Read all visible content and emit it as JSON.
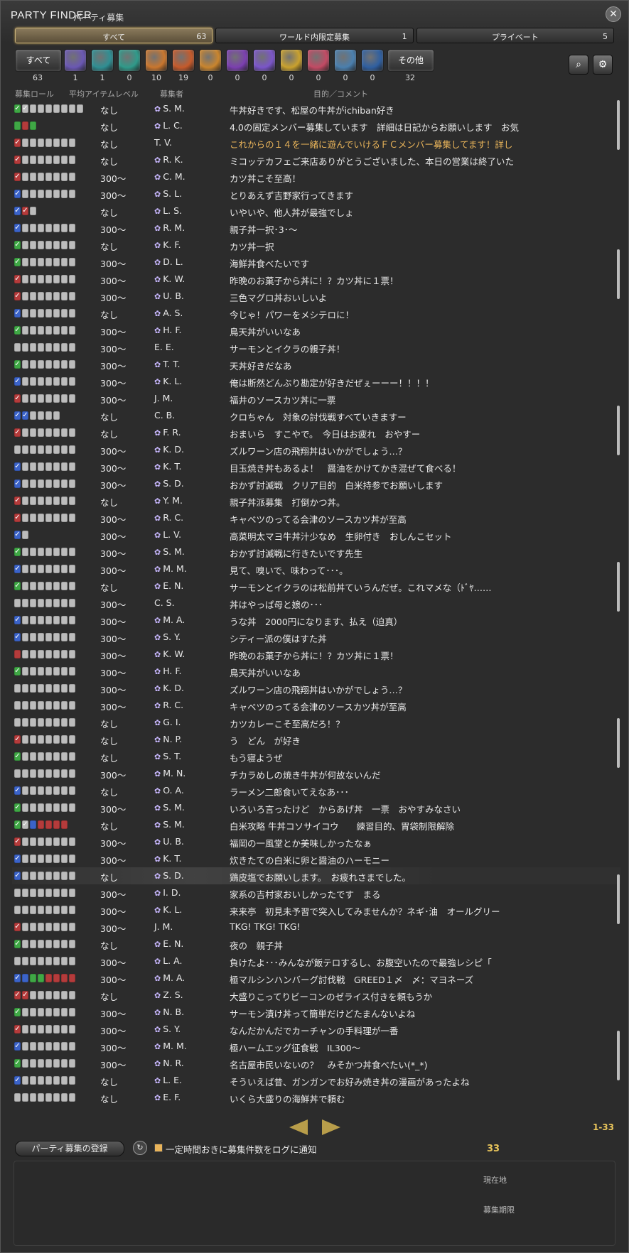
{
  "window": {
    "title": "PARTY FINDER",
    "subtitle": "パーティ募集",
    "close_icon": "close-icon"
  },
  "tabs": [
    {
      "label": "すべて",
      "count": "63"
    },
    {
      "label": "ワールド内限定募集",
      "count": "1"
    },
    {
      "label": "プライベート",
      "count": "5"
    }
  ],
  "filters": [
    {
      "label": "すべて",
      "count": "63",
      "color": "#555555"
    },
    {
      "icon": "dungeon-icon",
      "count": "1",
      "color": "#6a57b3"
    },
    {
      "icon": "guildhest-icon",
      "count": "1",
      "color": "#2f8f93"
    },
    {
      "icon": "trial-icon",
      "count": "0",
      "color": "#2f9a8a"
    },
    {
      "icon": "raid-icon",
      "count": "10",
      "color": "#c9762e"
    },
    {
      "icon": "high-end-icon",
      "count": "19",
      "color": "#c55a2b"
    },
    {
      "icon": "pvp-icon",
      "count": "0",
      "color": "#c9852e"
    },
    {
      "icon": "quest-battle-icon",
      "count": "0",
      "color": "#7b3fb0"
    },
    {
      "icon": "fate-icon",
      "count": "0",
      "color": "#7a55c9"
    },
    {
      "icon": "treasure-hunt-icon",
      "count": "0",
      "color": "#c9a12e"
    },
    {
      "icon": "hunt-icon",
      "count": "0",
      "color": "#c24a64"
    },
    {
      "icon": "gathering-icon",
      "count": "0",
      "color": "#4a7fae"
    },
    {
      "icon": "deep-dungeon-icon",
      "count": "0",
      "color": "#2f5fa0"
    },
    {
      "label": "その他",
      "count": "32",
      "color": "#555555"
    }
  ],
  "columns": {
    "role": "募集ロール",
    "ilvl": "平均アイテムレベル",
    "recruiter": "募集者",
    "comment": "目的／コメント"
  },
  "rows": [
    {
      "roles": "HG0000000",
      "ilvl": "なし",
      "name": "S. M.",
      "comment": "牛丼好きです、松屋の牛丼がichiban好き"
    },
    {
      "roles": "hdg",
      "ilvl": "なし",
      "name": "L. C.",
      "comment": "4.0の固定メンバー募集しています　詳細は日記からお願いします　お気"
    },
    {
      "roles": "D0000000",
      "ilvl": "なし",
      "name": "T. V.",
      "comment": "これからの１４を一緒に遊んでいけるＦＣメンバー募集してます！詳し",
      "orange": true
    },
    {
      "roles": "D0000000",
      "ilvl": "なし",
      "name": "R. K.",
      "comment": "ミコッテカフェご来店ありがとうございました、本日の営業は終了いた"
    },
    {
      "roles": "D0000000",
      "ilvl": "300～",
      "name": "C. M.",
      "comment": "カツ丼こそ至高！"
    },
    {
      "roles": "T0000000",
      "ilvl": "300～",
      "name": "S. L.",
      "comment": "とりあえず吉野家行ってきます"
    },
    {
      "roles": "TD0",
      "ilvl": "なし",
      "name": "L. S.",
      "comment": "いやいや、他人丼が最強でしょ"
    },
    {
      "roles": "T0000000",
      "ilvl": "300～",
      "name": "R. M.",
      "comment": "親子丼一択･3･～"
    },
    {
      "roles": "H0000000",
      "ilvl": "なし",
      "name": "K. F.",
      "comment": "カツ丼一択"
    },
    {
      "roles": "H0000000",
      "ilvl": "300～",
      "name": "D. L.",
      "comment": "海鮮丼食べたいです"
    },
    {
      "roles": "D0000000",
      "ilvl": "300～",
      "name": "K. W.",
      "comment": "昨晩のお菓子から丼に！？カツ丼に１票！"
    },
    {
      "roles": "D0000000",
      "ilvl": "300～",
      "name": "U. B.",
      "comment": "三色マグロ丼おいしいよ"
    },
    {
      "roles": "T0000000",
      "ilvl": "なし",
      "name": "A. S.",
      "comment": "今じゃ！パワーをメシテロに！"
    },
    {
      "roles": "H0000000",
      "ilvl": "300～",
      "name": "H. F.",
      "comment": "鳥天丼がいいなあ"
    },
    {
      "roles": "00000000",
      "ilvl": "300～",
      "name": "E. E.",
      "comment": "サーモンとイクラの親子丼！"
    },
    {
      "roles": "H0000000",
      "ilvl": "300～",
      "name": "T. T.",
      "comment": "天丼好きだなあ"
    },
    {
      "roles": "T0000000",
      "ilvl": "300～",
      "name": "K. L.",
      "comment": "俺は断然どんぶり勘定が好きだぜぇーーー！！！！"
    },
    {
      "roles": "D0000000",
      "ilvl": "300～",
      "name": "J. M.",
      "comment": "福井のソースカツ丼に一票"
    },
    {
      "roles": "TT0000",
      "ilvl": "なし",
      "name": "C. B.",
      "comment": "クロちゃん　対象の討伐戦すべていきますー"
    },
    {
      "roles": "D0000000",
      "ilvl": "なし",
      "name": "F. R.",
      "comment": "おまいら　すこやで。　今日はお疲れ　おやすー"
    },
    {
      "roles": "00000000",
      "ilvl": "300～",
      "name": "K. D.",
      "comment": "ズルワーン店の飛翔丼はいかがでしょう…？"
    },
    {
      "roles": "T0000000",
      "ilvl": "300～",
      "name": "K. T.",
      "comment": "目玉焼き丼もあるよ！　醤油をかけてかき混ぜて食べる！"
    },
    {
      "roles": "T0000000",
      "ilvl": "300～",
      "name": "S. D.",
      "comment": "おかず討滅戦　クリア目的　白米持参でお願いします"
    },
    {
      "roles": "D0000000",
      "ilvl": "なし",
      "name": "Y. M.",
      "comment": "親子丼派募集　打倒かつ丼。"
    },
    {
      "roles": "D0000000",
      "ilvl": "300～",
      "name": "R. C.",
      "comment": "キャベツのってる会津のソースカツ丼が至高"
    },
    {
      "roles": "T0",
      "ilvl": "300～",
      "name": "L. V.",
      "comment": "高菜明太マヨ牛丼汁少なめ　生卵付き　おしんこセット"
    },
    {
      "roles": "H0000000",
      "ilvl": "300～",
      "name": "S. M.",
      "comment": "おかず討滅戦に行きたいです先生"
    },
    {
      "roles": "T0000000",
      "ilvl": "300～",
      "name": "M. M.",
      "comment": "見て、嗅いで、味わって･･･。"
    },
    {
      "roles": "H0000000",
      "ilvl": "なし",
      "name": "E. N.",
      "comment": "サーモンとイクラのは松前丼ていうんだぜ。これマメな（ﾄﾞﾔ……"
    },
    {
      "roles": "00000000",
      "ilvl": "300～",
      "name": "C. S.",
      "comment": "丼はやっぱ母と娘の･･･"
    },
    {
      "roles": "T0000000",
      "ilvl": "300～",
      "name": "M. A.",
      "comment": "うな丼　2000円になります、払え（迫真）"
    },
    {
      "roles": "T0000000",
      "ilvl": "300～",
      "name": "S. Y.",
      "comment": "シティー派の僕はすた丼"
    },
    {
      "roles": "d0000000",
      "ilvl": "300～",
      "name": "K. W.",
      "comment": "昨晩のお菓子から丼に！？カツ丼に１票！"
    },
    {
      "roles": "H0000000",
      "ilvl": "300～",
      "name": "H. F.",
      "comment": "鳥天丼がいいなあ"
    },
    {
      "roles": "00000000",
      "ilvl": "300～",
      "name": "K. D.",
      "comment": "ズルワーン店の飛翔丼はいかがでしょう…？"
    },
    {
      "roles": "00000000",
      "ilvl": "300～",
      "name": "R. C.",
      "comment": "キャベツのってる会津のソースカツ丼が至高"
    },
    {
      "roles": "00000000",
      "ilvl": "なし",
      "name": "G. I.",
      "comment": "カツカレーこそ至高だろ！？"
    },
    {
      "roles": "D0000000",
      "ilvl": "なし",
      "name": "N. P.",
      "comment": "う　どん　が好き"
    },
    {
      "roles": "H0000000",
      "ilvl": "なし",
      "name": "S. T.",
      "comment": "もう寝ようぜ"
    },
    {
      "roles": "00000000",
      "ilvl": "300～",
      "name": "M. N.",
      "comment": "チカラめしの焼き牛丼が何故ないんだ"
    },
    {
      "roles": "T0000000",
      "ilvl": "なし",
      "name": "O. A.",
      "comment": "ラーメン二郎食いてえなあ･･･"
    },
    {
      "roles": "H0000000",
      "ilvl": "300～",
      "name": "S. M.",
      "comment": "いろいろ言ったけど　からあげ丼　一票　おやすみなさい"
    },
    {
      "roles": "HGtdddd",
      "ilvl": "なし",
      "name": "S. M.",
      "comment": "白米攻略 牛丼コソサイコウ　　練習目的、胃袋制限解除"
    },
    {
      "roles": "D0000000",
      "ilvl": "300～",
      "name": "U. B.",
      "comment": "福岡の一風堂とか美味しかったなぁ"
    },
    {
      "roles": "T0000000",
      "ilvl": "300～",
      "name": "K. T.",
      "comment": "炊きたての白米に卵と醤油のハーモニー"
    },
    {
      "roles": "T0000000",
      "ilvl": "なし",
      "name": "S. D.",
      "comment": "鶏皮塩でお願いします。　お疲れさまでした。",
      "highlight": true
    },
    {
      "roles": "00000000",
      "ilvl": "300～",
      "name": "I. D.",
      "comment": "家系の吉村家おいしかったです　まる"
    },
    {
      "roles": "00000000",
      "ilvl": "300～",
      "name": "K. L.",
      "comment": "来来亭　初見未予習で突入してみませんか？ネギ･油　オールグリー"
    },
    {
      "roles": "D0000000",
      "ilvl": "300～",
      "name": "J. M.",
      "comment": "TKG! TKG! TKG!"
    },
    {
      "roles": "H0000000",
      "ilvl": "なし",
      "name": "E. N.",
      "comment": "夜の　親子丼"
    },
    {
      "roles": "00000000",
      "ilvl": "300～",
      "name": "L. A.",
      "comment": "負けたよ･･･みんなが飯テロするし、お腹空いたので最強レシピ「"
    },
    {
      "roles": "Ttghdddd",
      "ilvl": "300～",
      "name": "M. A.",
      "comment": "極マルシンハンバーグ討伐戦　GREED１〆　〆：マヨネーズ"
    },
    {
      "roles": "DD000000",
      "ilvl": "なし",
      "name": "Z. S.",
      "comment": "大盛りこってりビーコンのゼライス付きを頼もうか"
    },
    {
      "roles": "H0000000",
      "ilvl": "300～",
      "name": "N. B.",
      "comment": "サーモン漬け丼って簡単だけどたまんないよね"
    },
    {
      "roles": "D0000000",
      "ilvl": "300～",
      "name": "S. Y.",
      "comment": "なんだかんだでカーチャンの手料理が一番"
    },
    {
      "roles": "T0000000",
      "ilvl": "300～",
      "name": "M. M.",
      "comment": "極ハームエッグ征食戦　IL300～"
    },
    {
      "roles": "H0000000",
      "ilvl": "300～",
      "name": "N. R.",
      "comment": "名古屋市民いないの？　みそかつ丼食べたい(*_*)"
    },
    {
      "roles": "T0000000",
      "ilvl": "なし",
      "name": "L. E.",
      "comment": "そういえば昔、ガンガンでお好み焼き丼の漫画があったよね"
    },
    {
      "roles": "00000000",
      "ilvl": "なし",
      "name": "E. F.",
      "comment": "いくら大盛りの海鮮丼で頼む"
    }
  ],
  "pager": {
    "range": "1-33"
  },
  "footer": {
    "register_label": "パーティ募集の登録",
    "notify_label": "一定時間おきに募集件数をログに通知",
    "count": "33"
  },
  "detail": {
    "location_label": "現在地",
    "deadline_label": "募集期限"
  }
}
